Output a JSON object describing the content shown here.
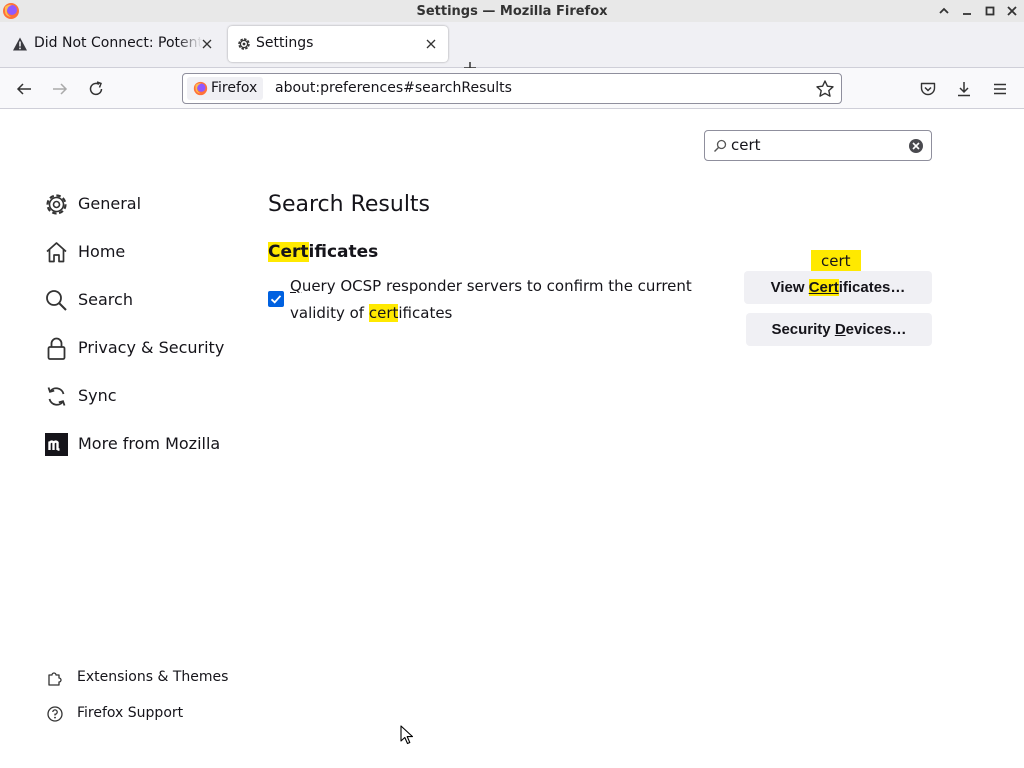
{
  "window": {
    "title": "Settings — Mozilla Firefox"
  },
  "tabs": [
    {
      "label": "Did Not Connect: Potential Security Issue",
      "icon": "warning-icon",
      "active": false
    },
    {
      "label": "Settings",
      "icon": "gear-icon",
      "active": true
    }
  ],
  "urlbar": {
    "identity_label": "Firefox",
    "url": "about:preferences#searchResults"
  },
  "search": {
    "query": "cert"
  },
  "sidebar": {
    "items": [
      {
        "label": "General",
        "icon": "gear-icon"
      },
      {
        "label": "Home",
        "icon": "home-icon"
      },
      {
        "label": "Search",
        "icon": "search-icon"
      },
      {
        "label": "Privacy & Security",
        "icon": "lock-icon"
      },
      {
        "label": "Sync",
        "icon": "sync-icon"
      },
      {
        "label": "More from Mozilla",
        "icon": "mozilla-icon"
      }
    ],
    "footer": [
      {
        "label": "Extensions & Themes",
        "icon": "puzzle-icon"
      },
      {
        "label": "Firefox Support",
        "icon": "help-icon"
      }
    ]
  },
  "main": {
    "heading": "Search Results",
    "group": {
      "title_hl": "Cert",
      "title_rest": "ificates"
    },
    "ocsp": {
      "checked": true,
      "accesskey": "Q",
      "text_1": "uery OCSP responder servers to confirm the current validity of ",
      "hl": "cert",
      "text_2": "ificates"
    },
    "view_button": {
      "pre": "View ",
      "hl": "Cert",
      "post": "ificates…"
    },
    "security_button": {
      "pre": "Security ",
      "accesskey": "D",
      "post": "evices…"
    },
    "tooltip": "cert"
  },
  "colors": {
    "highlight": "#ffe900",
    "accent": "#0061e0"
  }
}
